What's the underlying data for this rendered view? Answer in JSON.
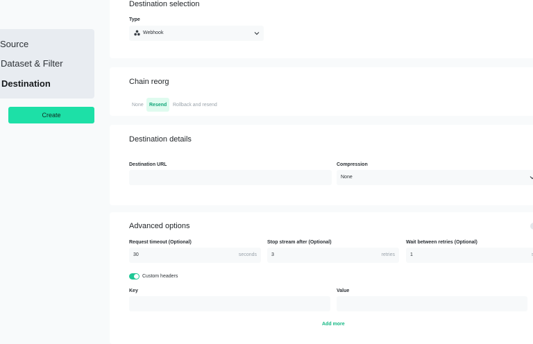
{
  "sidebar": {
    "steps": [
      {
        "label": "Source",
        "active": false
      },
      {
        "label": "Dataset & Filter",
        "active": false
      },
      {
        "label": "Destination",
        "active": true
      }
    ],
    "create_label": "Create"
  },
  "destination_selection": {
    "title": "Destination selection",
    "type_label": "Type",
    "type_value": "Webhook",
    "type_icon": "webhook-icon"
  },
  "chain_reorg": {
    "title": "Chain reorg",
    "options": [
      "None",
      "Resend",
      "Rollback and resend"
    ],
    "selected": "Resend"
  },
  "destination_details": {
    "title": "Destination details",
    "url_label": "Destination URL",
    "url_value": "",
    "compression_label": "Compression",
    "compression_value": "None"
  },
  "advanced_options": {
    "title": "Advanced options",
    "request_timeout_label": "Request timeout (Optional)",
    "request_timeout_value": "30",
    "request_timeout_unit": "seconds",
    "stop_stream_label": "Stop stream after (Optional)",
    "stop_stream_value": "3",
    "stop_stream_unit": "retries",
    "wait_retries_label": "Wait between retries (Optional)",
    "wait_retries_value": "1",
    "wait_retries_unit": "seconds",
    "custom_headers_label": "Custom headers",
    "custom_headers_enabled": true,
    "key_label": "Key",
    "value_label": "Value",
    "key_value": "",
    "value_value": "",
    "add_more_label": "Add more"
  },
  "colors": {
    "accent": "#1de0a7",
    "accent_text": "#12a679",
    "background": "#f8fafb",
    "card": "#ffffff"
  }
}
